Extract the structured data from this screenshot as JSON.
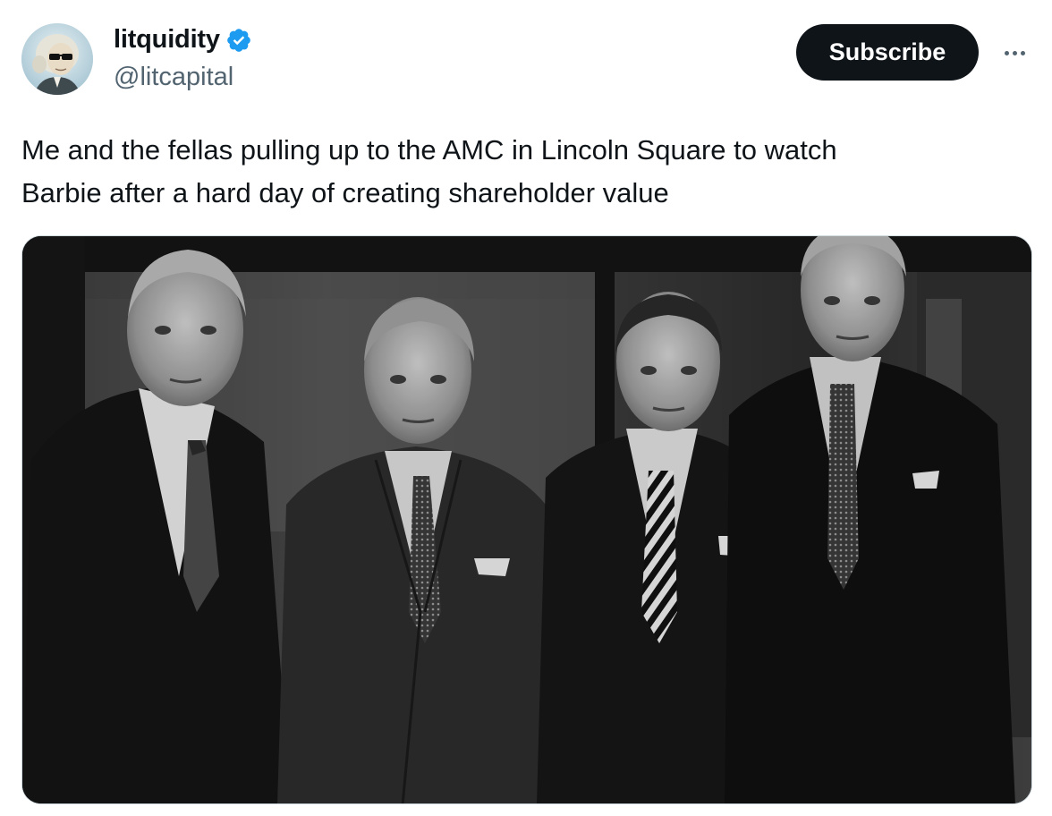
{
  "author": {
    "display_name": "litquidity",
    "handle": "@litcapital",
    "verified": true,
    "avatar_icon": "avatar-washington-sunglasses"
  },
  "actions": {
    "subscribe_label": "Subscribe",
    "more_icon": "more-horizontal-icon"
  },
  "tweet": {
    "text": "Me and the fellas pulling up to the AMC in Lincoln Square to watch\nBarbie after a hard day of creating shareholder value"
  },
  "media": {
    "type": "photo",
    "style": "black-and-white"
  },
  "colors": {
    "text_primary": "#0f1419",
    "text_secondary": "#536471",
    "verified_blue": "#1d9bf0",
    "button_bg": "#0f1419",
    "border": "#cfd9de"
  }
}
